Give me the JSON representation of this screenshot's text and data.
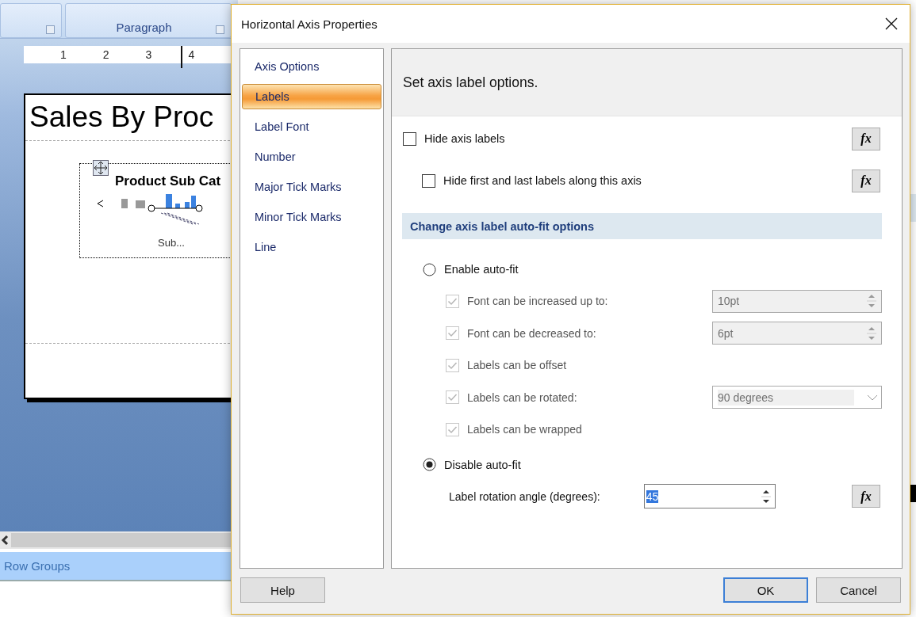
{
  "background": {
    "ribbon_group": "Paragraph",
    "ruler_marks": [
      "1",
      "2",
      "3",
      "4"
    ],
    "report_title": "Sales By Proc",
    "chart_title": "Product Sub Cat",
    "chart_axis_label": "Sub...",
    "row_groups": "Row Groups"
  },
  "dialog": {
    "title": "Horizontal Axis Properties",
    "nav": [
      {
        "label": "Axis Options",
        "selected": false
      },
      {
        "label": "Labels",
        "selected": true
      },
      {
        "label": "Label Font",
        "selected": false
      },
      {
        "label": "Number",
        "selected": false
      },
      {
        "label": "Major Tick Marks",
        "selected": false
      },
      {
        "label": "Minor Tick Marks",
        "selected": false
      },
      {
        "label": "Line",
        "selected": false
      }
    ],
    "header": "Set axis label options.",
    "hide_options": [
      {
        "label": "Hide axis labels",
        "checked": false,
        "fx_button": "fx"
      },
      {
        "label": "Hide first and last labels along this axis",
        "checked": false,
        "fx_button": "fx"
      }
    ],
    "section_title": "Change axis label auto-fit options",
    "enable_autofit": {
      "label": "Enable auto-fit",
      "selected": false
    },
    "autofit_options": [
      {
        "kind": "spin",
        "label": "Font can be increased up to:",
        "checked": true,
        "disabled": true,
        "value": "10pt"
      },
      {
        "kind": "spin",
        "label": "Font can be decreased to:",
        "checked": true,
        "disabled": true,
        "value": "6pt"
      },
      {
        "kind": "check",
        "label": "Labels can be offset",
        "checked": true,
        "disabled": true
      },
      {
        "kind": "dropdown",
        "label": "Labels can be rotated:",
        "checked": true,
        "disabled": true,
        "value": "90 degrees"
      },
      {
        "kind": "check",
        "label": "Labels can be wrapped",
        "checked": true,
        "disabled": true
      }
    ],
    "disable_autofit": {
      "label": "Disable auto-fit",
      "selected": true
    },
    "rotation_angle": {
      "label": "Label rotation angle (degrees):",
      "value": "45",
      "fx_button": "fx"
    },
    "buttons": [
      {
        "label": "Help",
        "default": false
      },
      {
        "label": "OK",
        "default": true
      },
      {
        "label": "Cancel",
        "default": false
      }
    ]
  }
}
